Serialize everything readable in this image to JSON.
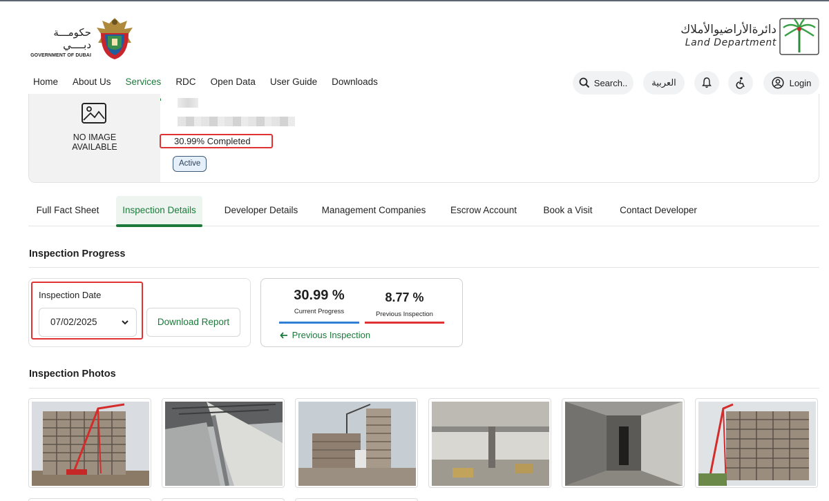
{
  "header": {
    "gov_name_ar": "حكومـــة دبــــي",
    "gov_name_en": "GOVERNMENT OF DUBAI",
    "ld_name_ar": "دائرةالأراضيوالأملاك",
    "ld_name_en": "Land Department"
  },
  "nav": {
    "items": [
      {
        "label": "Home"
      },
      {
        "label": "About Us"
      },
      {
        "label": "Services",
        "active": true
      },
      {
        "label": "RDC"
      },
      {
        "label": "Open Data"
      },
      {
        "label": "User Guide"
      },
      {
        "label": "Downloads"
      }
    ],
    "search_label": "Search..",
    "language_label": "العربية",
    "login_label": "Login"
  },
  "project": {
    "no_image_line1": "NO IMAGE",
    "no_image_line2": "AVAILABLE",
    "completion_text": "30.99% Completed",
    "status": "Active"
  },
  "tabs": [
    {
      "label": "Full Fact Sheet"
    },
    {
      "label": "Inspection Details",
      "active": true
    },
    {
      "label": "Developer Details"
    },
    {
      "label": "Management Companies"
    },
    {
      "label": "Escrow Account"
    },
    {
      "label": "Book a Visit"
    },
    {
      "label": "Contact Developer"
    }
  ],
  "inspection": {
    "section_title": "Inspection Progress",
    "date_label": "Inspection Date",
    "date_value": "07/02/2025",
    "download_label": "Download Report",
    "current_value": "30.99 %",
    "current_label": "Current Progress",
    "previous_value": "8.77 %",
    "previous_label": "Previous Inspection",
    "previous_link": "Previous Inspection"
  },
  "photos": {
    "section_title": "Inspection Photos",
    "count_visible": 6
  },
  "colors": {
    "brand_green": "#1b7a3a",
    "highlight_red": "#e03232",
    "current_bar": "#2f7fd6",
    "previous_bar": "#e03232"
  }
}
